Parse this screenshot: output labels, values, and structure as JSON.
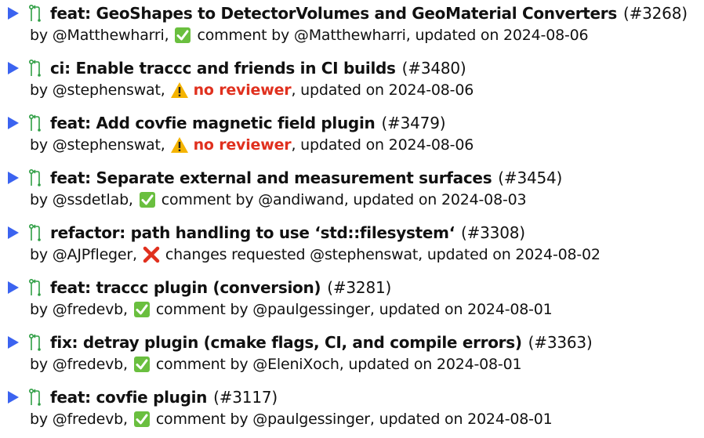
{
  "pull_requests": [
    {
      "title": "feat: GeoShapes to DetectorVolumes and GeoMaterial Converters",
      "number": "(#3268)",
      "by_text": "by @Matthewharri,",
      "status_icon": "check-icon",
      "status_text": "comment by @Matthewharri",
      "status_emphasis": false,
      "updated": ", updated on 2024-08-06"
    },
    {
      "title": "ci: Enable traccc and friends in CI builds",
      "number": "(#3480)",
      "by_text": "by @stephenswat,",
      "status_icon": "warning-icon",
      "status_text": "no reviewer",
      "status_emphasis": true,
      "updated": ", updated on 2024-08-06"
    },
    {
      "title": "feat: Add covfie magnetic field plugin",
      "number": "(#3479)",
      "by_text": "by @stephenswat,",
      "status_icon": "warning-icon",
      "status_text": "no reviewer",
      "status_emphasis": true,
      "updated": ", updated on 2024-08-06"
    },
    {
      "title": "feat: Separate external and measurement surfaces",
      "number": "(#3454)",
      "by_text": "by @ssdetlab,",
      "status_icon": "check-icon",
      "status_text": "comment by @andiwand",
      "status_emphasis": false,
      "updated": ", updated on 2024-08-03"
    },
    {
      "title": "refactor: path handling to use ‘std::filesystem‘",
      "number": "(#3308)",
      "by_text": "by @AJPfleger,",
      "status_icon": "cross-icon",
      "status_text": "changes requested @stephenswat",
      "status_emphasis": false,
      "updated": ", updated on 2024-08-02"
    },
    {
      "title": "feat: traccc plugin (conversion)",
      "number": "(#3281)",
      "by_text": "by @fredevb,",
      "status_icon": "check-icon",
      "status_text": "comment by @paulgessinger",
      "status_emphasis": false,
      "updated": ", updated on 2024-08-01"
    },
    {
      "title": "fix: detray plugin (cmake flags, CI, and compile errors)",
      "number": "(#3363)",
      "by_text": "by @fredevb,",
      "status_icon": "check-icon",
      "status_text": "comment by @EleniXoch",
      "status_emphasis": false,
      "updated": ", updated on 2024-08-01"
    },
    {
      "title": "feat: covfie plugin",
      "number": "(#3117)",
      "by_text": "by @fredevb,",
      "status_icon": "check-icon",
      "status_text": "comment by @paulgessinger",
      "status_emphasis": false,
      "updated": ", updated on 2024-08-01"
    }
  ],
  "colors": {
    "triangle": "#3b63f0",
    "pr_icon": "#2f9e44",
    "check_bg": "#6abf3f",
    "warning": "#f5b400",
    "cross": "#e0301e",
    "no_reviewer_text": "#e0301e"
  }
}
